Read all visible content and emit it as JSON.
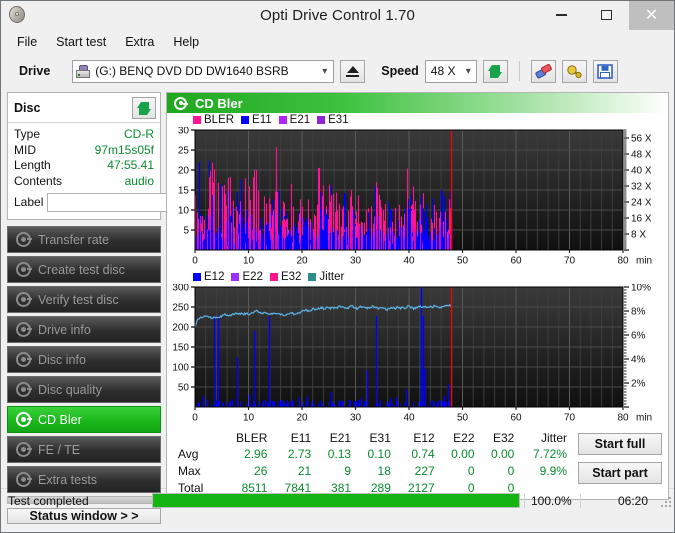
{
  "window": {
    "title": "Opti Drive Control 1.70",
    "app_icon": "cd-disc-icon",
    "minimize_label": "Minimize",
    "maximize_label": "Maximize",
    "close_label": "Close"
  },
  "menu": {
    "items": [
      {
        "label": "File",
        "name": "menu-file"
      },
      {
        "label": "Start test",
        "name": "menu-start-test"
      },
      {
        "label": "Extra",
        "name": "menu-extra"
      },
      {
        "label": "Help",
        "name": "menu-help"
      }
    ]
  },
  "toolbar": {
    "drive_label": "Drive",
    "drive_value": "(G:)   BENQ DVD DD DW1640 BSRB",
    "drive_icon": "optical-drive-icon",
    "eject_label": "Eject",
    "speed_label": "Speed",
    "speed_value": "48 X",
    "refresh_icon": "refresh-arrows-icon",
    "erase_icon": "eraser-icon",
    "plug_icon": "plug-icon",
    "save_icon": "floppy-save-icon"
  },
  "disc": {
    "header": "Disc",
    "refresh_icon": "refresh-arrows-icon",
    "rows": [
      {
        "key": "Type",
        "value": "CD-R"
      },
      {
        "key": "MID",
        "value": "97m15s05f"
      },
      {
        "key": "Length",
        "value": "47:55.41"
      },
      {
        "key": "Contents",
        "value": "audio"
      }
    ],
    "label_key": "Label",
    "label_value": "",
    "label_placeholder": "",
    "disc_button_icon": "cd-disc-icon"
  },
  "tests": {
    "items": [
      {
        "label": "Transfer rate",
        "name": "sidebar-item-transfer-rate",
        "active": false
      },
      {
        "label": "Create test disc",
        "name": "sidebar-item-create-test-disc",
        "active": false
      },
      {
        "label": "Verify test disc",
        "name": "sidebar-item-verify-test-disc",
        "active": false
      },
      {
        "label": "Drive info",
        "name": "sidebar-item-drive-info",
        "active": false
      },
      {
        "label": "Disc info",
        "name": "sidebar-item-disc-info",
        "active": false
      },
      {
        "label": "Disc quality",
        "name": "sidebar-item-disc-quality",
        "active": false
      },
      {
        "label": "CD Bler",
        "name": "sidebar-item-cd-bler",
        "active": true
      },
      {
        "label": "FE / TE",
        "name": "sidebar-item-fe-te",
        "active": false
      },
      {
        "label": "Extra tests",
        "name": "sidebar-item-extra-tests",
        "active": false
      }
    ],
    "status_window_label": "Status window > >"
  },
  "panel": {
    "title": "CD Bler",
    "icon": "gear-disc-icon"
  },
  "actions": {
    "start_full": "Start full",
    "start_part": "Start part"
  },
  "statusbar": {
    "status": "Test completed",
    "progress_pct": "100.0%",
    "progress_value": 100,
    "elapsed": "06:20"
  },
  "colors": {
    "bler": "#ff1493",
    "e11": "#0000ff",
    "e21": "#b026ff",
    "e31": "#8e24e0",
    "e12": "#0000ff",
    "e22": "#9b30ff",
    "e32": "#ff1493",
    "jitter": "#2e8b8b",
    "jitter_line": "#5cb3e8",
    "cursor": "#ff0000",
    "accent_green": "#1bb81b",
    "value_green": "#0a8a2f"
  },
  "stats": {
    "columns": [
      "BLER",
      "E11",
      "E21",
      "E31",
      "E12",
      "E22",
      "E32",
      "Jitter"
    ],
    "rows": [
      {
        "label": "Avg",
        "values": [
          "2.96",
          "2.73",
          "0.13",
          "0.10",
          "0.74",
          "0.00",
          "0.00",
          "7.72%"
        ]
      },
      {
        "label": "Max",
        "values": [
          "26",
          "21",
          "9",
          "18",
          "227",
          "0",
          "0",
          "9.9%"
        ]
      },
      {
        "label": "Total",
        "values": [
          "8511",
          "7841",
          "381",
          "289",
          "2127",
          "0",
          "0",
          ""
        ]
      }
    ]
  },
  "chart_data": [
    {
      "type": "line",
      "name": "bler-chart",
      "title": "",
      "xlabel": "min",
      "ylabel": "",
      "xlim": [
        0,
        80
      ],
      "ylim": [
        0,
        30
      ],
      "yticks": [
        5,
        10,
        15,
        20,
        25,
        30
      ],
      "xticks": [
        0,
        10,
        20,
        30,
        40,
        50,
        60,
        70,
        80
      ],
      "y2label": "X",
      "y2ticks": [
        "8 X",
        "16 X",
        "24 X",
        "32 X",
        "40 X",
        "48 X",
        "56 X"
      ],
      "y2lim": [
        0,
        60
      ],
      "grid": true,
      "legend": [
        {
          "name": "BLER",
          "color": "#ff1493"
        },
        {
          "name": "E11",
          "color": "#0000ff"
        },
        {
          "name": "E21",
          "color": "#b026ff"
        },
        {
          "name": "E31",
          "color": "#8e24e0"
        }
      ],
      "data_end_x": 47.9,
      "cursor_x": 47.9,
      "series": [
        {
          "name": "BLER",
          "color": "#ff1493",
          "values": [
            13,
            11,
            9,
            12,
            21,
            21,
            19,
            22,
            16,
            14,
            18,
            13,
            11,
            9,
            14,
            21,
            15,
            12,
            19,
            14,
            10,
            13,
            15,
            12,
            9,
            26,
            18,
            13,
            10,
            15,
            11,
            9,
            13,
            16,
            12,
            14,
            10,
            9,
            19,
            17,
            14,
            18,
            13,
            11,
            15,
            10,
            12,
            9,
            14,
            11,
            13,
            10,
            9,
            12,
            14,
            11,
            18,
            13,
            10,
            12,
            9,
            14,
            11,
            16,
            13,
            10,
            19,
            15,
            12,
            9,
            11,
            13,
            10,
            8,
            12,
            9,
            11,
            14,
            10,
            13
          ]
        },
        {
          "name": "E11",
          "color": "#0000ff",
          "values": [
            8,
            19,
            7,
            14,
            20,
            22,
            9,
            16,
            11,
            8,
            21,
            12,
            9,
            13,
            18,
            21,
            11,
            8,
            14,
            12,
            9,
            15,
            21,
            11,
            8,
            12,
            17,
            9,
            13,
            10,
            8,
            14,
            11,
            9,
            16,
            12,
            10,
            8,
            13,
            11,
            21,
            9,
            14,
            12,
            10,
            8,
            15,
            11,
            9,
            13,
            10,
            12,
            8,
            14,
            11,
            9,
            18,
            12,
            10,
            8,
            13,
            11,
            9,
            15,
            12,
            10,
            21,
            14,
            11,
            9,
            12,
            10,
            8,
            13,
            11,
            9,
            14,
            12,
            10,
            13
          ]
        }
      ]
    },
    {
      "type": "line",
      "name": "e12-jitter-chart",
      "title": "",
      "xlabel": "min",
      "ylabel": "",
      "xlim": [
        0,
        80
      ],
      "ylim": [
        0,
        300
      ],
      "yticks": [
        50,
        100,
        150,
        200,
        250,
        300
      ],
      "xticks": [
        0,
        10,
        20,
        30,
        40,
        50,
        60,
        70,
        80
      ],
      "y2label": "%",
      "y2ticks": [
        "2%",
        "4%",
        "6%",
        "8%",
        "10%"
      ],
      "y2lim": [
        0,
        10
      ],
      "grid": true,
      "legend": [
        {
          "name": "E12",
          "color": "#0000ff"
        },
        {
          "name": "E22",
          "color": "#9b30ff"
        },
        {
          "name": "E32",
          "color": "#ff1493"
        },
        {
          "name": "Jitter",
          "color": "#2e8b8b"
        }
      ],
      "data_end_x": 47.9,
      "cursor_x": 47.9,
      "series": [
        {
          "name": "Jitter",
          "color": "#5cb3e8",
          "unit": "%",
          "values": [
            6.8,
            7.3,
            7.4,
            7.5,
            7.6,
            7.5,
            7.4,
            7.5,
            7.5,
            7.4,
            7.6,
            7.7,
            7.7,
            7.6,
            7.7,
            7.8,
            7.7,
            7.8,
            7.7,
            7.8,
            7.7,
            7.8,
            7.9,
            8.0,
            7.9,
            7.8,
            7.9,
            7.8,
            7.7,
            7.8,
            7.7,
            7.8,
            7.7,
            7.6,
            7.7,
            7.8,
            7.8,
            7.7,
            7.8,
            7.9,
            8.0,
            8.1,
            8.0,
            8.1,
            8.2,
            8.1,
            8.2,
            8.3,
            8.2,
            8.3,
            8.2,
            8.3,
            8.2,
            8.3,
            8.4,
            8.3,
            8.2,
            8.3,
            8.4,
            8.3,
            8.2,
            8.3,
            8.4,
            8.3,
            8.2,
            8.3,
            8.4,
            8.3,
            8.2,
            8.3,
            8.2,
            8.1,
            8.2,
            8.3,
            8.2,
            8.3,
            8.2,
            8.3,
            8.2,
            8.4,
            8.3,
            8.2,
            8.3,
            8.4,
            8.3,
            8.4,
            8.3,
            8.4,
            8.3,
            8.5,
            8.4,
            8.3,
            8.4,
            8.5,
            8.4,
            8.5
          ]
        },
        {
          "name": "E12",
          "color": "#0000ff",
          "spikes": [
            [
              0.5,
              10
            ],
            [
              1.5,
              28
            ],
            [
              2.2,
              18
            ],
            [
              3.6,
              227
            ],
            [
              4.3,
              227
            ],
            [
              6.5,
              12
            ],
            [
              7.0,
              20
            ],
            [
              7.8,
              124
            ],
            [
              8.5,
              14
            ],
            [
              10.0,
              32
            ],
            [
              11.0,
              190
            ],
            [
              13.8,
              227
            ],
            [
              17.0,
              8
            ],
            [
              18.2,
              18
            ],
            [
              19.5,
              24
            ],
            [
              21.0,
              26
            ],
            [
              25.5,
              38
            ],
            [
              27.5,
              10
            ],
            [
              30.0,
              16
            ],
            [
              31.0,
              22
            ],
            [
              32.2,
              92
            ],
            [
              33.8,
              227
            ],
            [
              36.5,
              22
            ],
            [
              37.5,
              24
            ],
            [
              39.5,
              44
            ],
            [
              42.3,
              300
            ],
            [
              42.6,
              227
            ],
            [
              43.0,
              95
            ],
            [
              44.5,
              12
            ],
            [
              45.5,
              16
            ],
            [
              46.5,
              28
            ],
            [
              47.2,
              58
            ]
          ]
        }
      ]
    }
  ]
}
